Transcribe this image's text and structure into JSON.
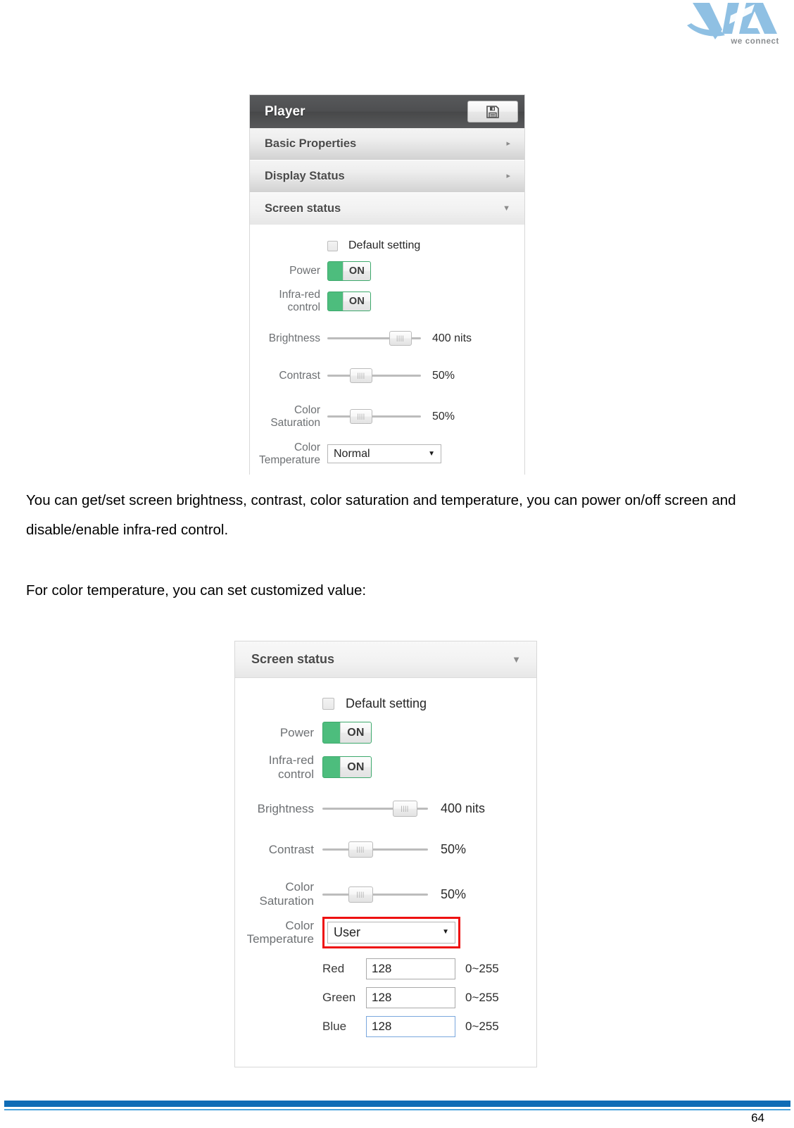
{
  "document": {
    "brand": {
      "name": "VIA",
      "tagline": "we connect",
      "logo_color": "#8fc0e3"
    },
    "paragraphs": [
      "You can get/set screen brightness, contrast, color saturation and temperature, you can power on/off screen and disable/enable infra-red control.",
      "For color temperature, you can set customized value:"
    ],
    "footer": {
      "page_number": "64",
      "bar_color": "#0f6cb6",
      "accent_color": "#4ba3dd"
    }
  },
  "panel_one": {
    "title": "Player",
    "save_button_label": "save-icon",
    "sections": [
      {
        "label": "Basic Properties",
        "state": "collapsed",
        "arrow": "▸"
      },
      {
        "label": "Display Status",
        "state": "collapsed",
        "arrow": "▸"
      },
      {
        "label": "Screen status",
        "state": "expanded",
        "arrow": "▼"
      }
    ],
    "form": {
      "default_setting": {
        "label": "Default setting",
        "checked": false
      },
      "power": {
        "label": "Power",
        "value": "ON",
        "on": true
      },
      "infrared": {
        "label": "Infra-red control",
        "label_line1": "Infra-red",
        "label_line2": "control",
        "value": "ON",
        "on": true
      },
      "brightness": {
        "label": "Brightness",
        "value": "400 nits",
        "percent": 78
      },
      "contrast": {
        "label": "Contrast",
        "value": "50%",
        "percent": 36
      },
      "saturation": {
        "label": "Color Saturation",
        "label_line1": "Color",
        "label_line2": "Saturation",
        "value": "50%",
        "percent": 36
      },
      "color_temperature": {
        "label_line1": "Color",
        "label_line2": "Temperature",
        "selected": "Normal",
        "caret": "▼"
      }
    }
  },
  "panel_two": {
    "section": {
      "label": "Screen status",
      "state": "expanded",
      "arrow": "▼"
    },
    "form": {
      "default_setting": {
        "label": "Default setting",
        "checked": false
      },
      "power": {
        "label": "Power",
        "value": "ON",
        "on": true
      },
      "infrared": {
        "label_line1": "Infra-red",
        "label_line2": "control",
        "value": "ON",
        "on": true
      },
      "brightness": {
        "label": "Brightness",
        "value": "400 nits",
        "percent": 78
      },
      "contrast": {
        "label": "Contrast",
        "value": "50%",
        "percent": 36
      },
      "saturation": {
        "label_line1": "Color",
        "label_line2": "Saturation",
        "value": "50%",
        "percent": 36
      },
      "color_temperature": {
        "label_line1": "Color",
        "label_line2": "Temperature",
        "selected": "User",
        "caret": "▼",
        "highlight_color": "#ee1111"
      },
      "rgb": [
        {
          "label": "Red",
          "value": "128",
          "range": "0~255",
          "focused": false
        },
        {
          "label": "Green",
          "value": "128",
          "range": "0~255",
          "focused": false
        },
        {
          "label": "Blue",
          "value": "128",
          "range": "0~255",
          "focused": true
        }
      ]
    }
  }
}
